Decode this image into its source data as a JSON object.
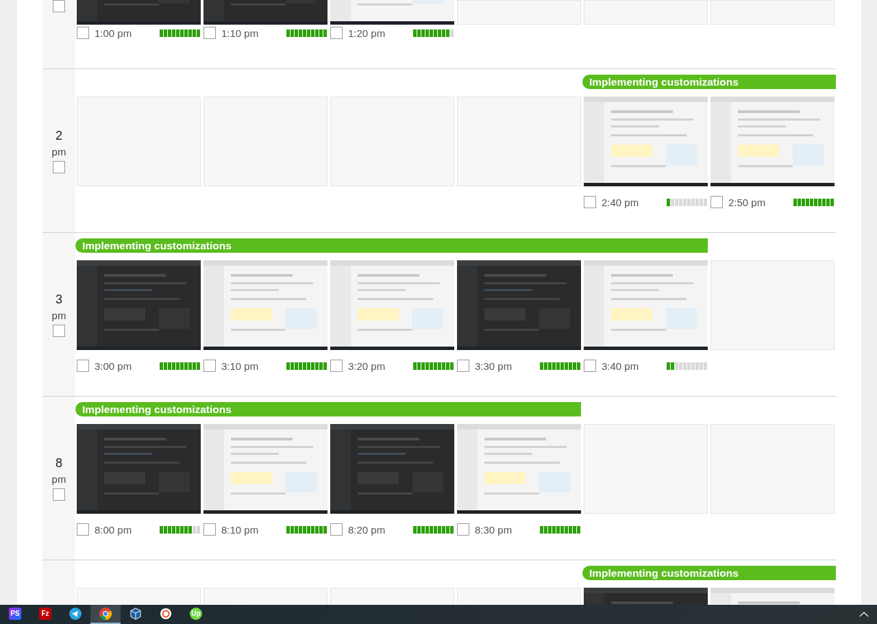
{
  "rows": [
    {
      "hour": null,
      "slots": [
        {
          "kind": "dark",
          "time": "1:00 pm",
          "checked": false,
          "level": 1
        },
        {
          "kind": "dark",
          "time": "1:10 pm",
          "checked": false,
          "level": 1
        },
        {
          "kind": "light",
          "time": "1:20 pm",
          "checked": false,
          "level": 0.9
        },
        {
          "kind": "empty"
        },
        {
          "kind": "empty"
        },
        {
          "kind": "empty"
        }
      ],
      "checked": false
    },
    {
      "hour": {
        "number": "2",
        "suffix": "pm"
      },
      "checked": false,
      "memo": "Implementing customizations",
      "slots": [
        {
          "kind": "empty"
        },
        {
          "kind": "empty"
        },
        {
          "kind": "empty"
        },
        {
          "kind": "empty"
        },
        {
          "kind": "light",
          "time": "2:40 pm",
          "checked": false,
          "level": 0.1
        },
        {
          "kind": "light",
          "time": "2:50 pm",
          "checked": false,
          "level": 1
        }
      ]
    },
    {
      "hour": {
        "number": "3",
        "suffix": "pm"
      },
      "checked": false,
      "memo": "Implementing customizations",
      "slots": [
        {
          "kind": "dark",
          "time": "3:00 pm",
          "checked": false,
          "level": 1
        },
        {
          "kind": "light",
          "time": "3:10 pm",
          "checked": false,
          "level": 1
        },
        {
          "kind": "light",
          "time": "3:20 pm",
          "checked": false,
          "level": 1
        },
        {
          "kind": "dark",
          "time": "3:30 pm",
          "checked": false,
          "level": 1
        },
        {
          "kind": "light",
          "time": "3:40 pm",
          "checked": false,
          "level": 0.2
        },
        {
          "kind": "empty"
        }
      ]
    },
    {
      "hour": {
        "number": "8",
        "suffix": "pm"
      },
      "checked": false,
      "memo": "Implementing customizations",
      "slots": [
        {
          "kind": "dark",
          "time": "8:00 pm",
          "checked": false,
          "level": 0.8
        },
        {
          "kind": "light",
          "time": "8:10 pm",
          "checked": false,
          "level": 1
        },
        {
          "kind": "dark",
          "time": "8:20 pm",
          "checked": false,
          "level": 1
        },
        {
          "kind": "light",
          "time": "8:30 pm",
          "checked": false,
          "level": 1
        },
        {
          "kind": "empty"
        },
        {
          "kind": "empty"
        }
      ]
    },
    {
      "hour": null,
      "memo": "Implementing customizations",
      "slots": [
        {
          "kind": "empty"
        },
        {
          "kind": "empty"
        },
        {
          "kind": "empty"
        },
        {
          "kind": "empty"
        },
        {
          "kind": "dark"
        },
        {
          "kind": "light"
        }
      ]
    }
  ],
  "taskbar": {
    "apps": [
      {
        "kind": "phpstorm",
        "glyph": "PS",
        "selected": false
      },
      {
        "kind": "filezilla",
        "glyph": "Fz",
        "selected": false
      },
      {
        "kind": "telegram",
        "selected": false
      },
      {
        "kind": "chrome",
        "selected": true
      },
      {
        "kind": "virtualbox",
        "selected": false
      },
      {
        "kind": "ubuntu",
        "selected": false
      },
      {
        "kind": "upwork",
        "glyph": "Up",
        "selected": false
      }
    ]
  }
}
